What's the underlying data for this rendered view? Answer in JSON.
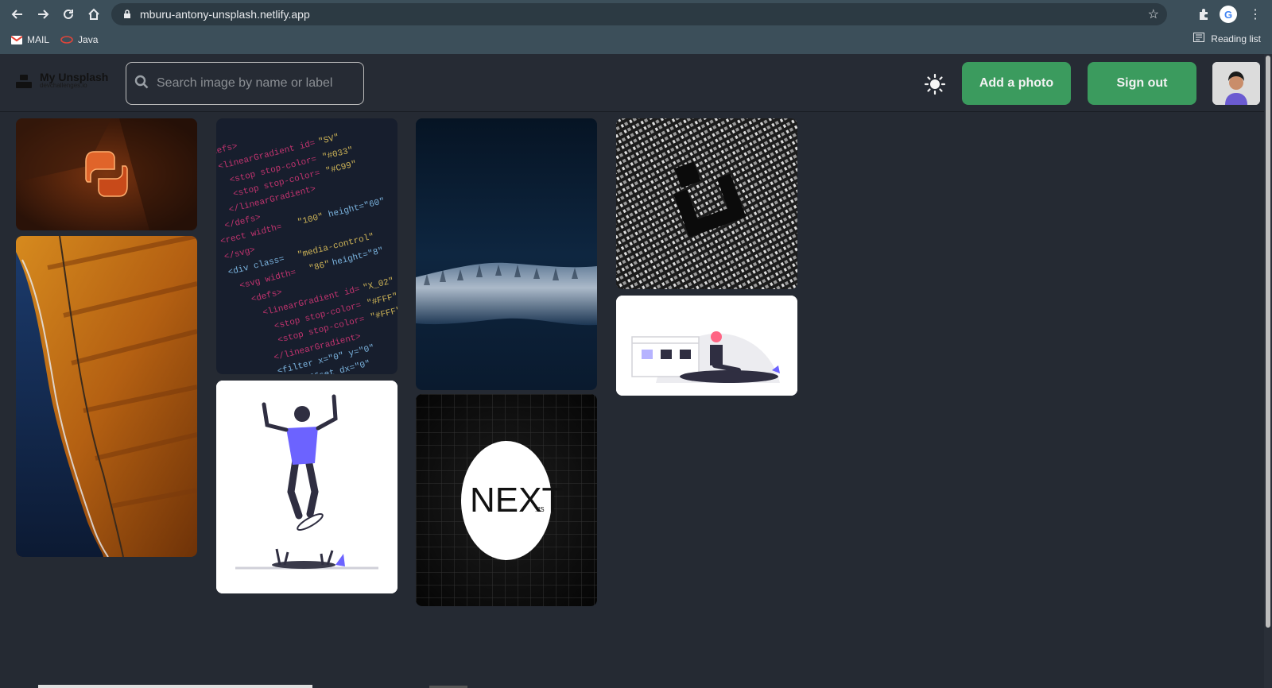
{
  "browser": {
    "url": "mburu-antony-unsplash.netlify.app",
    "bookmarks": [
      {
        "label": "MAIL",
        "icon": "gmail-icon"
      },
      {
        "label": "Java",
        "icon": "java-icon"
      }
    ],
    "reading_list_label": "Reading list",
    "profile_initial": "G"
  },
  "app": {
    "brand_name": "My Unsplash",
    "brand_sub": "devchallenges.io",
    "search_placeholder": "Search image by name or label",
    "theme_toggle_icon": "sun-icon",
    "add_photo_label": "Add a photo",
    "sign_out_label": "Sign out",
    "accent_color": "#3b9b5e"
  },
  "gallery": {
    "photos": [
      {
        "name": "python-logo-photo",
        "column": 1
      },
      {
        "name": "coastline-photo",
        "column": 1
      },
      {
        "name": "code-screen-photo",
        "column": 2
      },
      {
        "name": "skateboarder-illustration",
        "column": 2
      },
      {
        "name": "forest-photo",
        "column": 3
      },
      {
        "name": "nextjs-logo",
        "column": 3
      },
      {
        "name": "binary-lock-photo",
        "column": 4
      },
      {
        "name": "browser-illustration",
        "column": 4
      }
    ],
    "nextjs_text": "NEXT",
    "nextjs_suffix": ".JS"
  }
}
